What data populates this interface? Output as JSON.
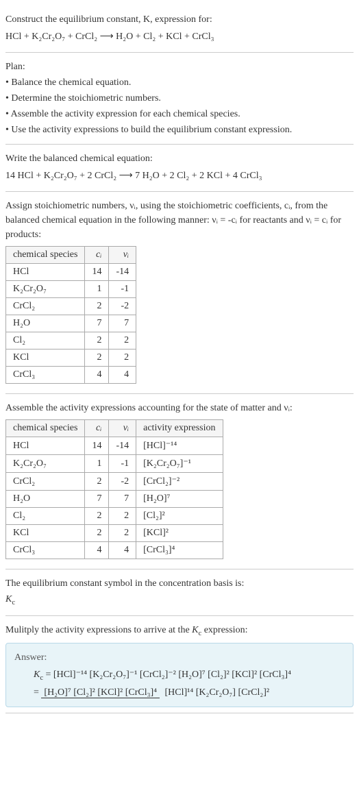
{
  "intro": {
    "line1": "Construct the equilibrium constant, K, expression for:",
    "eq": "HCl + K₂Cr₂O₇ + CrCl₂ ⟶ H₂O + Cl₂ + KCl + CrCl₃"
  },
  "plan": {
    "header": "Plan:",
    "items": [
      "• Balance the chemical equation.",
      "• Determine the stoichiometric numbers.",
      "• Assemble the activity expression for each chemical species.",
      "• Use the activity expressions to build the equilibrium constant expression."
    ]
  },
  "balanced": {
    "header": "Write the balanced chemical equation:",
    "eq": "14 HCl + K₂Cr₂O₇ + 2 CrCl₂ ⟶ 7 H₂O + 2 Cl₂ + 2 KCl + 4 CrCl₃"
  },
  "stoich": {
    "header_a": "Assign stoichiometric numbers, νᵢ, using the stoichiometric coefficients, cᵢ, from the balanced chemical equation in the following manner: νᵢ = -cᵢ for reactants and νᵢ = cᵢ for products:",
    "cols": {
      "species": "chemical species",
      "ci": "cᵢ",
      "vi": "νᵢ"
    },
    "rows": [
      {
        "sp": "HCl",
        "ci": "14",
        "vi": "-14"
      },
      {
        "sp": "K₂Cr₂O₇",
        "ci": "1",
        "vi": "-1"
      },
      {
        "sp": "CrCl₂",
        "ci": "2",
        "vi": "-2"
      },
      {
        "sp": "H₂O",
        "ci": "7",
        "vi": "7"
      },
      {
        "sp": "Cl₂",
        "ci": "2",
        "vi": "2"
      },
      {
        "sp": "KCl",
        "ci": "2",
        "vi": "2"
      },
      {
        "sp": "CrCl₃",
        "ci": "4",
        "vi": "4"
      }
    ]
  },
  "activity": {
    "header": "Assemble the activity expressions accounting for the state of matter and νᵢ:",
    "cols": {
      "species": "chemical species",
      "ci": "cᵢ",
      "vi": "νᵢ",
      "ae": "activity expression"
    },
    "rows": [
      {
        "sp": "HCl",
        "ci": "14",
        "vi": "-14",
        "ae": "[HCl]⁻¹⁴"
      },
      {
        "sp": "K₂Cr₂O₇",
        "ci": "1",
        "vi": "-1",
        "ae": "[K₂Cr₂O₇]⁻¹"
      },
      {
        "sp": "CrCl₂",
        "ci": "2",
        "vi": "-2",
        "ae": "[CrCl₂]⁻²"
      },
      {
        "sp": "H₂O",
        "ci": "7",
        "vi": "7",
        "ae": "[H₂O]⁷"
      },
      {
        "sp": "Cl₂",
        "ci": "2",
        "vi": "2",
        "ae": "[Cl₂]²"
      },
      {
        "sp": "KCl",
        "ci": "2",
        "vi": "2",
        "ae": "[KCl]²"
      },
      {
        "sp": "CrCl₃",
        "ci": "4",
        "vi": "4",
        "ae": "[CrCl₃]⁴"
      }
    ]
  },
  "symbol": {
    "line": "The equilibrium constant symbol in the concentration basis is:",
    "sym": "K_c"
  },
  "multiply": {
    "line": "Mulitply the activity expressions to arrive at the K_c expression:"
  },
  "answer": {
    "label": "Answer:",
    "line1": "K_c = [HCl]⁻¹⁴ [K₂Cr₂O₇]⁻¹ [CrCl₂]⁻² [H₂O]⁷ [Cl₂]² [KCl]² [CrCl₃]⁴",
    "eq": "=",
    "num": "[H₂O]⁷ [Cl₂]² [KCl]² [CrCl₃]⁴",
    "den": "[HCl]¹⁴ [K₂Cr₂O₇] [CrCl₂]²"
  }
}
